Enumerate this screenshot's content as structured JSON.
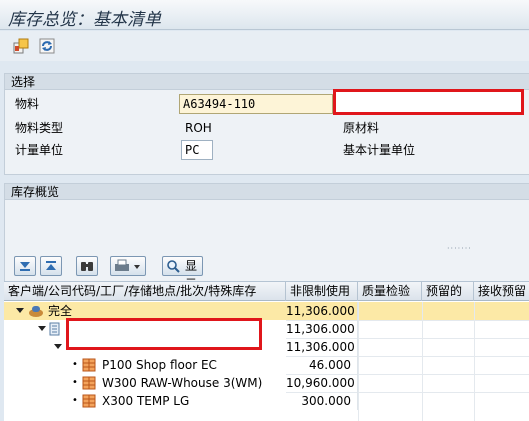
{
  "window": {
    "title": "库存总览：基本清单"
  },
  "toolbar": {
    "items": [
      {
        "name": "export-icon"
      },
      {
        "name": "refresh-icon"
      }
    ]
  },
  "selection": {
    "title": "选择",
    "material_label": "物料",
    "material_value": "A63494-110",
    "material_type_label": "物料类型",
    "material_type_value": "ROH",
    "material_type_desc": "原材料",
    "uom_label": "计量单位",
    "uom_value": "PC",
    "base_uom_label": "基本计量单位"
  },
  "overview": {
    "title": "库存概览",
    "buttons": {
      "expand_icon": "expand-all-icon",
      "collapse_icon": "collapse-all-icon",
      "find_icon": "binoculars-icon",
      "print_icon": "printer-icon",
      "detail_label": "显示明细"
    },
    "columns": [
      "客户端/公司代码/工厂/存储地点/批次/特殊库存",
      "非限制使用",
      "质量检验",
      "预留的",
      "接收预留"
    ],
    "rows": [
      {
        "label": "完全",
        "unrestricted": "11,306.000",
        "level": 0
      },
      {
        "label": "",
        "unrestricted": "11,306.000",
        "level": 1
      },
      {
        "label": "",
        "unrestricted": "11,306.000",
        "level": 2
      },
      {
        "label": "P100 Shop floor EC",
        "unrestricted": "46.000",
        "level": 3
      },
      {
        "label": "W300 RAW-Whouse 3(WM)",
        "unrestricted": "10,960.000",
        "level": 3
      },
      {
        "label": "X300 TEMP LG",
        "unrestricted": "300.000",
        "level": 3
      }
    ]
  },
  "colors": {
    "accent": "#e0161b",
    "selected_row": "#fce9a6",
    "header": "#24364a"
  }
}
